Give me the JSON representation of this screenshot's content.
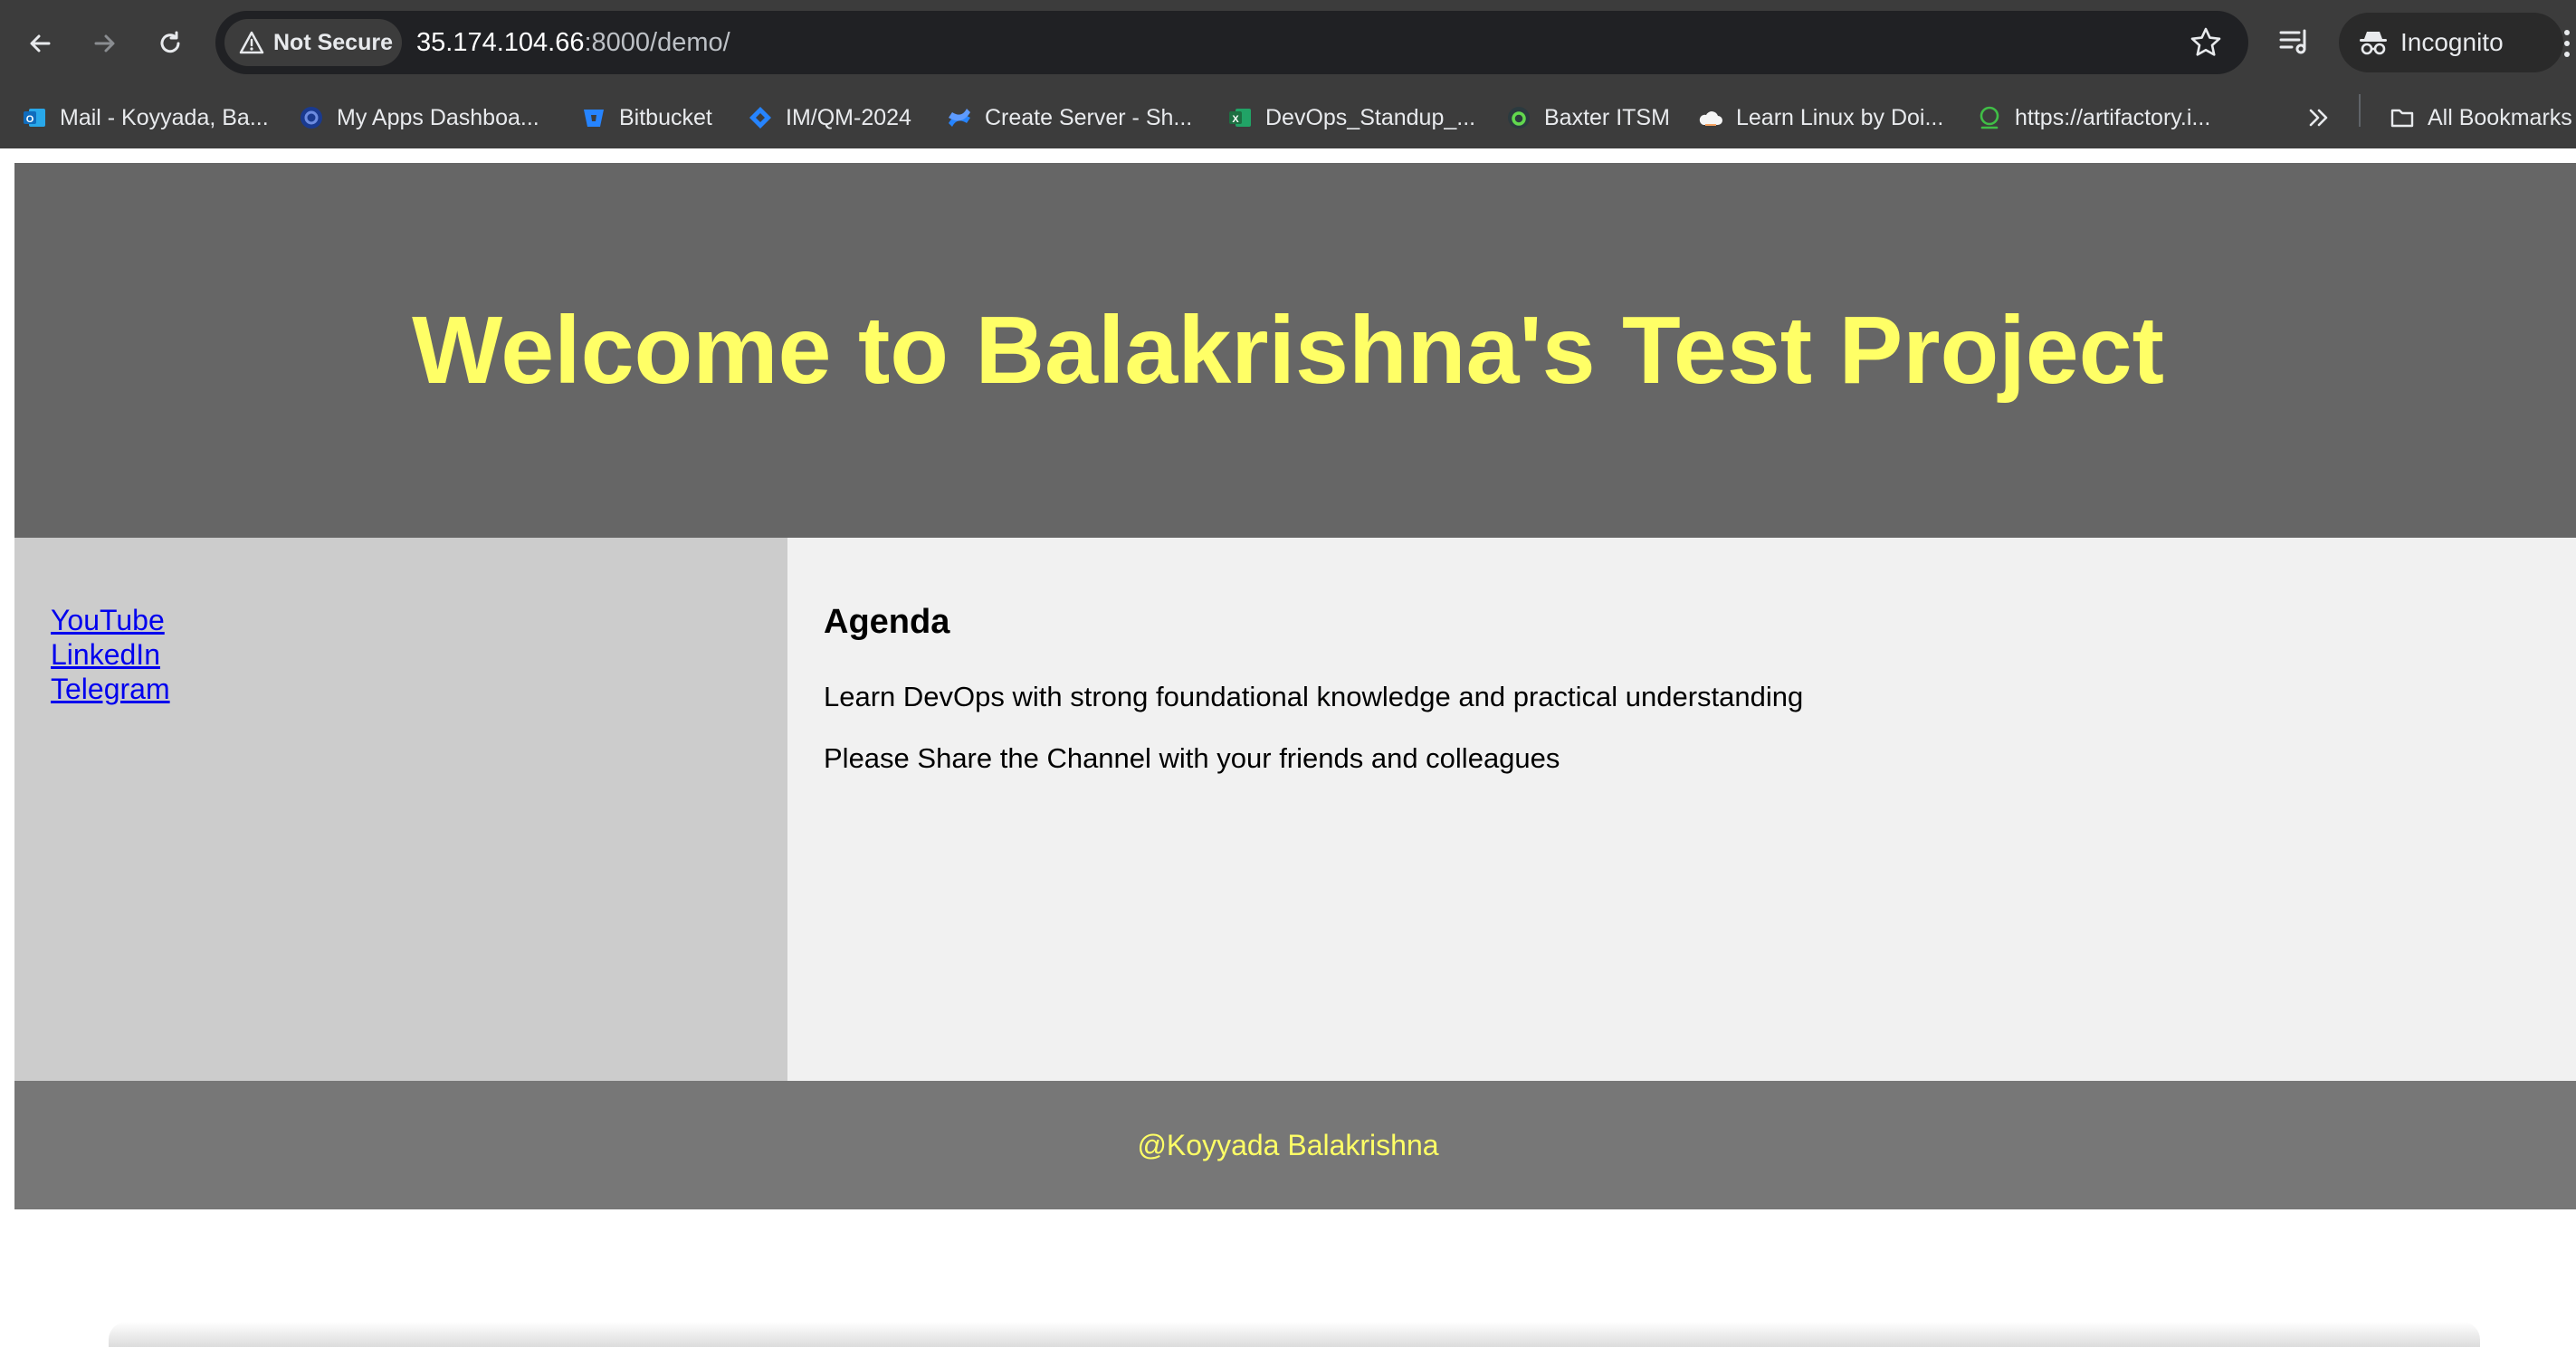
{
  "browser": {
    "security_label": "Not Secure",
    "url_host": "35.174.104.66",
    "url_rest": ":8000/demo/",
    "profile_label": "Incognito",
    "bookmarks": [
      {
        "label": "Mail - Koyyada, Ba...",
        "icon": "outlook-icon",
        "color": "#1a73e8"
      },
      {
        "label": "My Apps Dashboa...",
        "icon": "okta-icon",
        "color": "#1a3a8f"
      },
      {
        "label": "Bitbucket",
        "icon": "bitbucket-icon",
        "color": "#2684ff"
      },
      {
        "label": "IM/QM-2024",
        "icon": "jira-icon",
        "color": "#2684ff"
      },
      {
        "label": "Create Server - Sh...",
        "icon": "confluence-icon",
        "color": "#2684ff"
      },
      {
        "label": "DevOps_Standup_...",
        "icon": "excel-icon",
        "color": "#1d6f42"
      },
      {
        "label": "Baxter ITSM",
        "icon": "servicenow-icon",
        "color": "#62d84e"
      },
      {
        "label": "Learn Linux by Doi...",
        "icon": "cloud-icon",
        "color": "#f5f5f5"
      },
      {
        "label": "https://artifactory.i...",
        "icon": "artifactory-icon",
        "color": "#40be46"
      }
    ],
    "all_bookmarks_label": "All Bookmarks"
  },
  "page": {
    "header_title": "Welcome to Balakrishna's Test Project",
    "sidebar_links": [
      "YouTube",
      "LinkedIn",
      "Telegram"
    ],
    "agenda_heading": "Agenda",
    "paragraphs": [
      "Learn DevOps with strong foundational knowledge and practical understanding",
      "Please Share the Channel with your friends and colleagues"
    ],
    "footer_text": "@Koyyada Balakrishna"
  },
  "colors": {
    "header_bg": "#666666",
    "title_color": "#ffff66",
    "sidebar_bg": "#cccccc",
    "content_bg": "#f1f1f1",
    "footer_bg": "#777777",
    "link_color": "#0000ee"
  }
}
